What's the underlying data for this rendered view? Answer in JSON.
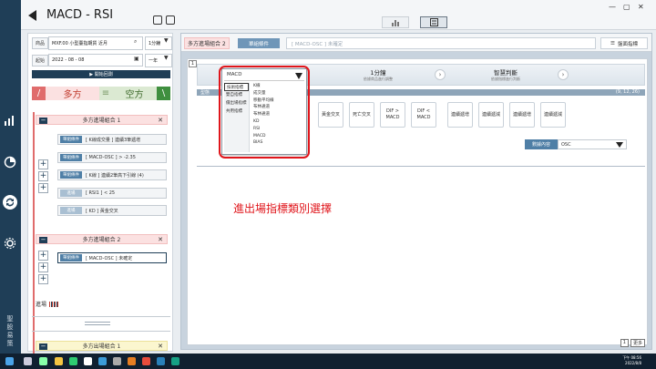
{
  "app": {
    "title": "MACD - RSI"
  },
  "rail": {
    "brand": "聖\n股\n易\n策"
  },
  "left": {
    "product_label": "商品",
    "product_value": "MXF.00 小型臺指期貨 近月",
    "interval_value": "1分鐘",
    "date_label": "起始",
    "date_value": "2022 - 08 - 08",
    "period_value": "一年",
    "play_label": "▶ 開始回測",
    "tab_long": "多方",
    "tab_short": "空方",
    "group1_title": "多方進場組合 1",
    "group1_conditions": [
      {
        "badge": "單組條件",
        "text": "[ K線成交量 ] 連續3筆遞增"
      },
      {
        "badge": "單組條件",
        "text": "[ MACD-OSC ] > -2.35"
      },
      {
        "badge": "單組條件",
        "text": "[ K線 ] 連續2筆高下引線 (4)"
      },
      {
        "badge": "進場",
        "text": "[ RSI1 ] < 25"
      },
      {
        "badge": "進場",
        "text": "[ KD ] 黃金交叉"
      }
    ],
    "group2_title": "多方進場組合 2",
    "group2_conditions": [
      {
        "badge": "單組條件",
        "text": "[ MACD-OSC ] 未確定"
      }
    ],
    "entry_label": "進場",
    "exit_group_title": "多方出場組合 1"
  },
  "main": {
    "combo_tag": "多方進場組合 2",
    "single_button": "單組條件",
    "formula_placeholder": "[ MACD-OSC ] 未確定",
    "chart_button": "盤面指標",
    "work_num": "1",
    "strip_interval_main": "1分鐘",
    "strip_interval_sub": "依據商品進行調整",
    "strip_mode_main": "智慧判斷",
    "strip_mode_sub": "依據指標進行判斷",
    "bar_left": "型態",
    "bar_right": "(9, 12, 26)",
    "indicator_buttons": [
      "黃金交叉",
      "死亡交叉",
      "DIF >\nMACD",
      "DIF <\nMACD",
      "連續遞增",
      "連續遞減",
      "連續遞增",
      "連續遞減"
    ],
    "data_label": "數據內容",
    "data_value": "OSC",
    "note": "進出場指標類別選擇",
    "page_indicator": [
      "1",
      "更多"
    ]
  },
  "dropdown": {
    "selected": "MACD",
    "categories": [
      "技術指標",
      "雙自指標",
      "價出場指標",
      "共用指標"
    ],
    "items": [
      "K線",
      "成交量",
      "移動平均線",
      "布林通道",
      "布林通道",
      "KD",
      "RSI",
      "MACD",
      "BIAS"
    ]
  },
  "taskbar": {
    "time": "下午 08:56",
    "date": "2022/8/8"
  },
  "colors": {
    "accent": "#1f3e57",
    "long": "#fbe1e1",
    "short": "#dbe9d2",
    "highlight": "#e0151b"
  }
}
